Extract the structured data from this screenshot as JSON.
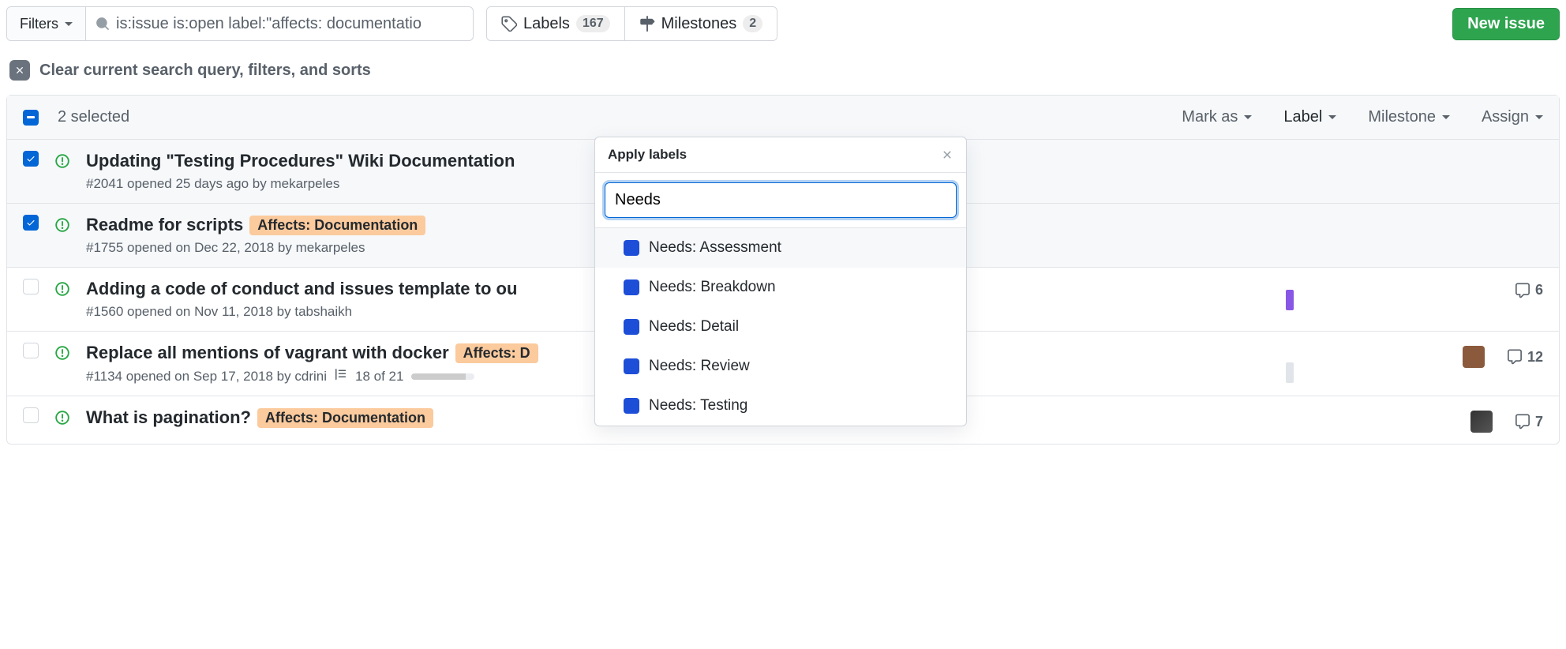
{
  "toolbar": {
    "filters_label": "Filters",
    "search_value": "is:issue is:open label:\"affects: documentatio",
    "labels_label": "Labels",
    "labels_count": "167",
    "milestones_label": "Milestones",
    "milestones_count": "2",
    "new_issue_label": "New issue"
  },
  "clear": {
    "text": "Clear current search query, filters, and sorts"
  },
  "list_head": {
    "selected_text": "2 selected",
    "actions": [
      "Mark as",
      "Label",
      "Milestone",
      "Assign"
    ]
  },
  "issues": [
    {
      "checked": true,
      "title": "Updating \"Testing Procedures\" Wiki Documentation",
      "meta": "#2041 opened 25 days ago by mekarpeles",
      "labels": []
    },
    {
      "checked": true,
      "title": "Readme for scripts",
      "meta": "#1755 opened on Dec 22, 2018 by mekarpeles",
      "labels": [
        "Affects: Documentation"
      ]
    },
    {
      "checked": false,
      "title": "Adding a code of conduct and issues template to ou",
      "meta": "#1560 opened on Nov 11, 2018 by tabshaikh",
      "labels": [],
      "comments": "6"
    },
    {
      "checked": false,
      "title": "Replace all mentions of vagrant with docker",
      "meta": "#1134 opened on Sep 17, 2018 by cdrini",
      "labels": [
        "Affects: D"
      ],
      "progress_text": "18 of 21",
      "progress_pct": 86,
      "avatar": "a1",
      "comments": "12"
    },
    {
      "checked": false,
      "title": "What is pagination?",
      "meta": "",
      "labels": [
        "Affects: Documentation"
      ],
      "avatar": "a2",
      "comments": "7",
      "partial": true
    }
  ],
  "popover": {
    "title": "Apply labels",
    "search_value": "Needs",
    "options": [
      "Needs: Assessment",
      "Needs: Breakdown",
      "Needs: Detail",
      "Needs: Review",
      "Needs: Testing"
    ]
  }
}
